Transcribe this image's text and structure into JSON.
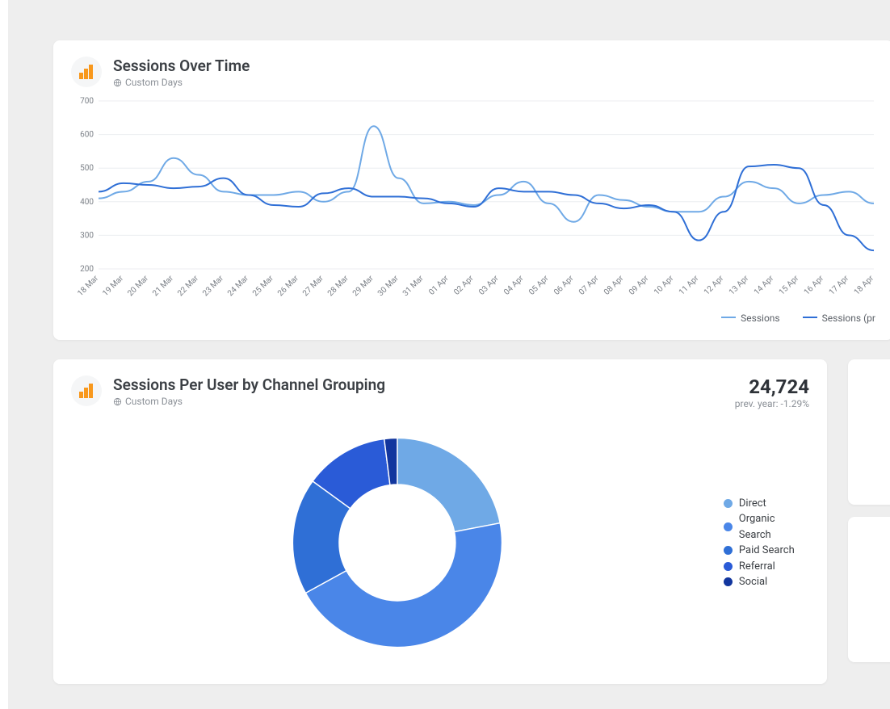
{
  "cards": {
    "line": {
      "title": "Sessions Over Time",
      "subtitle": "Custom Days"
    },
    "donut": {
      "title": "Sessions Per User by Channel Grouping",
      "subtitle": "Custom Days",
      "metric_value": "24,724",
      "metric_sub": "prev. year: -1.29%"
    }
  },
  "chart_data": [
    {
      "type": "line",
      "title": "Sessions Over Time",
      "xlabel": "",
      "ylabel": "",
      "ylim": [
        200,
        700
      ],
      "yticks": [
        200,
        300,
        400,
        500,
        600,
        700
      ],
      "categories": [
        "18 Mar",
        "19 Mar",
        "20 Mar",
        "21 Mar",
        "22 Mar",
        "23 Mar",
        "24 Mar",
        "25 Mar",
        "26 Mar",
        "27 Mar",
        "28 Mar",
        "29 Mar",
        "30 Mar",
        "31 Mar",
        "01 Apr",
        "02 Apr",
        "03 Apr",
        "04 Apr",
        "05 Apr",
        "06 Apr",
        "07 Apr",
        "08 Apr",
        "09 Apr",
        "10 Apr",
        "11 Apr",
        "12 Apr",
        "13 Apr",
        "14 Apr",
        "15 Apr",
        "16 Apr",
        "17 Apr",
        "18 Apr"
      ],
      "series": [
        {
          "name": "Sessions",
          "color": "#6fa9e6",
          "values": [
            410,
            430,
            460,
            530,
            480,
            430,
            420,
            420,
            430,
            400,
            430,
            625,
            470,
            395,
            400,
            390,
            420,
            460,
            395,
            340,
            420,
            405,
            385,
            370,
            370,
            415,
            460,
            440,
            395,
            420,
            430,
            395
          ]
        },
        {
          "name": "Sessions (pr",
          "color": "#2f6fd6",
          "values": [
            430,
            455,
            450,
            440,
            445,
            470,
            420,
            390,
            385,
            425,
            440,
            415,
            415,
            410,
            395,
            385,
            440,
            430,
            430,
            420,
            395,
            380,
            390,
            370,
            285,
            370,
            505,
            510,
            500,
            390,
            300,
            255
          ]
        }
      ],
      "legend": [
        "Sessions",
        "Sessions (pr"
      ]
    },
    {
      "type": "pie",
      "title": "Sessions Per User by Channel Grouping",
      "series": [
        {
          "name": "Direct",
          "value": 22,
          "color": "#6fa9e6"
        },
        {
          "name": "Organic Search",
          "value": 45,
          "color": "#4a86e8"
        },
        {
          "name": "Paid Search",
          "value": 18,
          "color": "#2f6fd6"
        },
        {
          "name": "Referral",
          "value": 13,
          "color": "#2a5bd7"
        },
        {
          "name": "Social",
          "value": 2,
          "color": "#12369e"
        }
      ],
      "legend_position": "right"
    }
  ]
}
